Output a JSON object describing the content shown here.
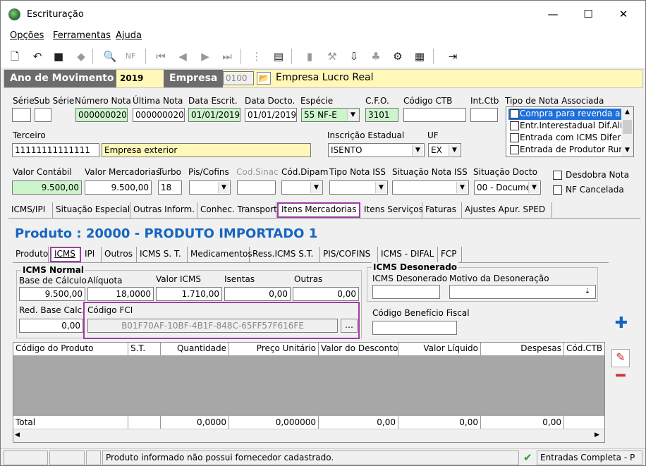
{
  "window": {
    "title": "Escrituração",
    "minimize": "—",
    "maximize": "☐",
    "close": "✕"
  },
  "menu": [
    "Opções",
    "Ferramentas",
    "Ajuda"
  ],
  "header": {
    "ano_label": "Ano de Movimento",
    "ano_value": "2019",
    "empresa_label": "Empresa",
    "empresa_code": "0100",
    "empresa_name": "Empresa Lucro Real"
  },
  "nota": {
    "labels": {
      "serie": "Série",
      "sub_serie": "Sub Série",
      "numero": "Número Nota",
      "ultima": "Última Nota",
      "data_escrit": "Data Escrit.",
      "data_docto": "Data Docto.",
      "especie": "Espécie",
      "cfo": "C.F.O.",
      "codigo_ctb": "Código CTB",
      "int_ctb": "Int.Ctb",
      "tipo_nota": "Tipo de Nota Associada",
      "terceiro": "Terceiro",
      "inscricao": "Inscrição Estadual",
      "uf": "UF"
    },
    "serie": "",
    "sub_serie": "",
    "numero": "0000000200",
    "ultima": "0000000200",
    "data_escrit": "01/01/2019",
    "data_docto": "01/01/2019",
    "especie": "55   NF-E",
    "cfo": "3101",
    "codigo_ctb": "",
    "int_ctb": "",
    "terceiro_code": "11111111111111",
    "terceiro_name": "Empresa exterior",
    "inscricao": "ISENTO",
    "uf": "EX",
    "tipo_nota_items": [
      "Compra para revenda a co",
      "Entr.Interestadual Dif.Alíq",
      "Entrada com ICMS Diferido",
      "Entrada de Produtor Rural"
    ]
  },
  "valores": {
    "labels": {
      "valor_contabil": "Valor Contábil",
      "valor_merc": "Valor Mercadorias",
      "turbo": "Turbo",
      "pis": "Pis/Cofins",
      "cod_sinac": "Cod.Sinac",
      "cod_dipam": "Cód.Dipam",
      "tipo_iss": "Tipo Nota ISS",
      "sit_iss": "Situação Nota ISS",
      "sit_docto": "Situação Docto"
    },
    "valor_contabil": "9.500,00",
    "valor_merc": "9.500,00",
    "turbo": "18",
    "sit_docto": "00 - Documer",
    "desdobra": "Desdobra Nota",
    "cancelada": "NF Cancelada"
  },
  "main_tabs": [
    "ICMS/IPI",
    "Situação Especial",
    "Outras Inform.",
    "Conhec. Transporte",
    "Itens Mercadorias",
    "Itens Serviços",
    "Faturas",
    "Ajustes Apur. SPED"
  ],
  "produto_title": "Produto : 20000 - PRODUTO IMPORTADO 1",
  "sub_tabs": [
    "Produto",
    "ICMS",
    "IPI",
    "Outros",
    "ICMS S. T.",
    "Medicamentos",
    "Ress.ICMS S.T.",
    "PIS/COFINS",
    "ICMS - DIFAL",
    "FCP"
  ],
  "icms": {
    "group_title": "ICMS Normal",
    "labels": {
      "base": "Base de Cálculo",
      "aliquota": "Alíquota",
      "valor": "Valor ICMS",
      "isentas": "Isentas",
      "outras": "Outras",
      "red_base": "Red. Base Calc.",
      "fci": "Código FCI"
    },
    "base": "9.500,00",
    "aliquota": "18,0000",
    "valor": "1.710,00",
    "isentas": "0,00",
    "outras": "0,00",
    "red_base": "0,00",
    "fci": "B01F70AF-10BF-4B1F-848C-65FF57F616FE"
  },
  "desonerado": {
    "group_title": "ICMS Desonerado",
    "label_icms": "ICMS Desonerado",
    "label_motivo": "Motivo da Desoneração",
    "label_beneficio": "Código Benefício Fiscal"
  },
  "grid": {
    "columns": [
      "Código do Produto",
      "S.T.",
      "Quantidade",
      "Preço Unitário",
      "Valor do Desconto",
      "Valor Líquido",
      "Despesas",
      "Cód.CTB"
    ],
    "total_label": "Total",
    "totals": [
      "0,0000",
      "0,000000",
      "0,00",
      "0,00",
      "0,00"
    ]
  },
  "status": {
    "message": "Produto informado não possui fornecedor cadastrado.",
    "right": "Entradas Completa - P"
  },
  "colors": {
    "accent_blue": "#1565c0",
    "highlight": "#9b3fa0",
    "header_gray": "#6c6c6c",
    "header_yellow": "#fff8b8",
    "green_field": "#ccf5cc"
  }
}
